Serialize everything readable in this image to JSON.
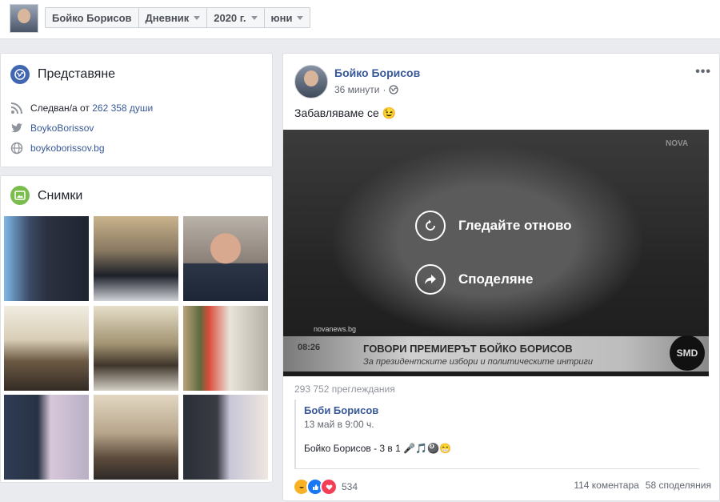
{
  "topbar": {
    "crumbs": [
      "Бойко Борисов",
      "Дневник",
      "2020 г.",
      "юни"
    ]
  },
  "intro": {
    "title": "Представяне",
    "followed_prefix": "Следван/а от",
    "followed_link": "262 358 души",
    "twitter": "BoykoBorissov",
    "website": "boykoborissov.bg"
  },
  "photos": {
    "title": "Снимки"
  },
  "post": {
    "author": "Бойко Борисов",
    "time": "36 минути",
    "text": "Забавляваме се",
    "emoji": "😉",
    "video": {
      "replay_label": "Гледайте отново",
      "share_label": "Споделяне",
      "ticker_main": "ГОВОРИ ПРЕМИЕРЪТ БОЙКО БОРИСОВ",
      "ticker_sub": "За президентските избори и политическите интриги",
      "channel_logo": "NOVA",
      "watermark": "SMD",
      "site": "novanews.bg",
      "clock": "08:26"
    },
    "views": "293 752 преглеждания",
    "shared": {
      "author": "Боби Борисов",
      "date": "13 май в 9:00 ч.",
      "text": "Бойко Борисов - 3 в 1",
      "emojis": "🎤🎵🎱😁"
    },
    "reactions_count": "534",
    "comments": "114 коментара",
    "shares": "58 споделяния"
  },
  "colors": {
    "link": "#385898",
    "background": "#e9ebee",
    "card": "#ffffff",
    "accent_blue": "#4267b2"
  }
}
